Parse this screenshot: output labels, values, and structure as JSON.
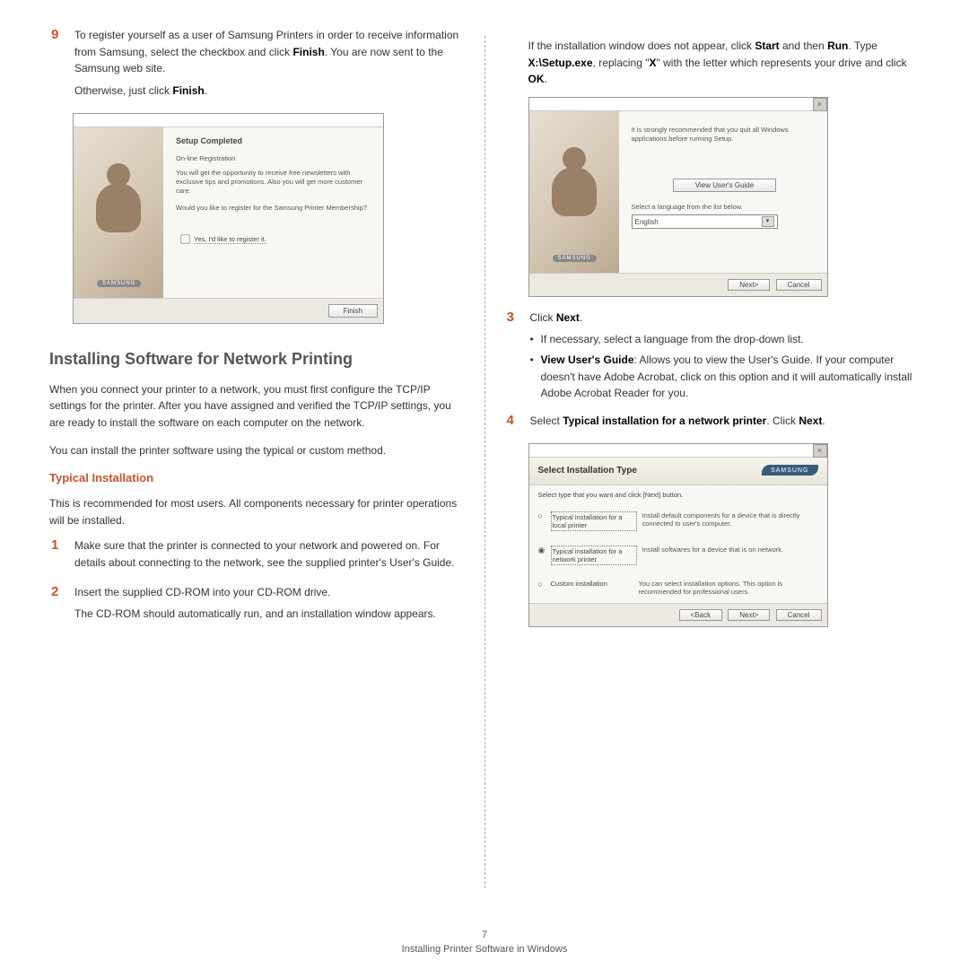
{
  "left": {
    "step9": {
      "num": "9",
      "p1a": "To register yourself as a user of Samsung Printers in order to receive information from Samsung, select the checkbox and click ",
      "p1b": "Finish",
      "p1c": ". You are now sent to the Samsung web site.",
      "p2a": "Otherwise, just click ",
      "p2b": "Finish",
      "p2c": "."
    },
    "shot1": {
      "title": "Setup Completed",
      "reg_h": "On-line Registration",
      "reg_p": "You will get the opportunity to receive free newsletters with exclusive tips and promotions. Also you will get more customer care.",
      "q": "Would you like to register for the Samsung Printer Membership?",
      "cb": "Yes, I'd like to register it.",
      "brand": "SAMSUNG",
      "finish": "Finish"
    },
    "h2": "Installing Software for Network Printing",
    "intro1": "When you connect your printer to a network, you must first configure the TCP/IP settings for the printer. After you have assigned and verified the TCP/IP settings, you are ready to install the software on each computer on the network.",
    "intro2": "You can install the printer software using the typical or custom method.",
    "sub_h": "Typical Installation",
    "sub_p": "This is recommended for most users. All components necessary for printer operations will be installed.",
    "step1": {
      "num": "1",
      "p": "Make sure that the printer is connected to your network and powered on. For details about connecting to the network, see the supplied printer's User's Guide."
    },
    "step2": {
      "num": "2",
      "p1": "Insert the supplied CD-ROM into your CD-ROM drive.",
      "p2": "The CD-ROM should automatically run, and an installation window appears."
    }
  },
  "right": {
    "top_a": "If the installation window does not appear, click ",
    "top_b": "Start",
    "top_c": " and then ",
    "top_d": "Run",
    "top_e": ". Type ",
    "top_f": "X:\\Setup.exe",
    "top_g": ", replacing \"",
    "top_h": "X",
    "top_i": "\" with the letter which represents your drive and click ",
    "top_j": "OK",
    "top_k": ".",
    "shot2": {
      "rec": "It is strongly recommended that you quit all Windows applications before running Setup.",
      "guide": "View User's Guide",
      "lang_lbl": "Select a language from the list below.",
      "lang_val": "English",
      "brand": "SAMSUNG",
      "next": "Next>",
      "cancel": "Cancel"
    },
    "step3": {
      "num": "3",
      "p_a": "Click ",
      "p_b": "Next",
      "p_c": ".",
      "b1": "If necessary, select a language from the drop-down list.",
      "b2a": "View User's Guide",
      "b2b": ": Allows you to view the User's Guide. If your computer doesn't have Adobe Acrobat, click on this option and it will automatically install Adobe Acrobat Reader for you."
    },
    "step4": {
      "num": "4",
      "p_a": "Select ",
      "p_b": "Typical installation for a network printer",
      "p_c": ". Click ",
      "p_d": "Next",
      "p_e": "."
    },
    "shot3": {
      "h": "Select Installation Type",
      "brand": "SAMSUNG",
      "inst": "Select type that you want and click [Next] button.",
      "o1_l": "Typical installation for a local printer",
      "o1_d": "Install default components for a device that is directly connected to user's computer.",
      "o2_l": "Typical installation for a network printer",
      "o2_d": "Install softwares for a device that is on network.",
      "o3_l": "Custom installation",
      "o3_d": "You can select installation options. This option is recommended for professional users.",
      "back": "<Back",
      "next": "Next>",
      "cancel": "Cancel"
    }
  },
  "footer": {
    "page": "7",
    "title": "Installing Printer Software in Windows"
  }
}
